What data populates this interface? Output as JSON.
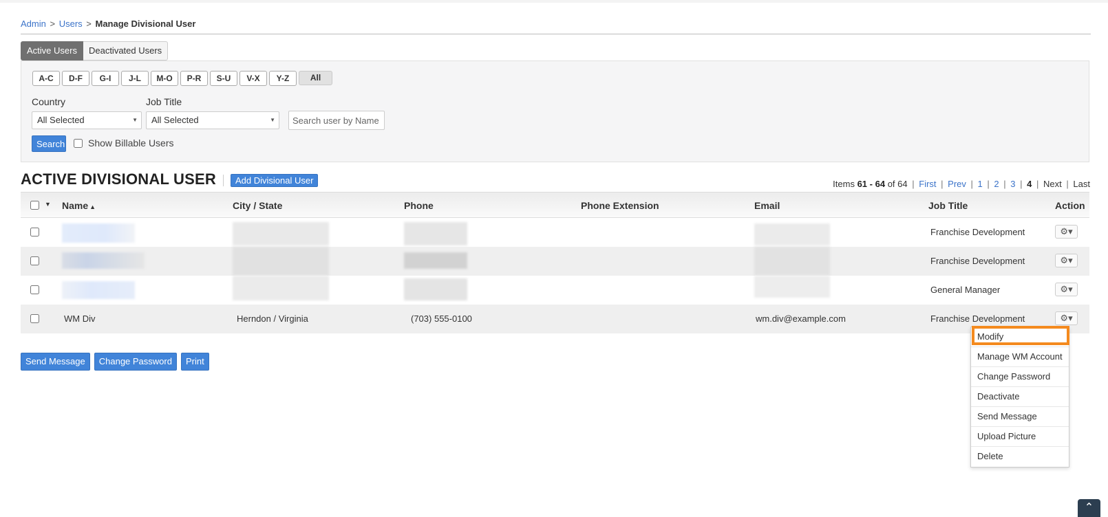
{
  "breadcrumb": {
    "admin": "Admin",
    "users": "Users",
    "current": "Manage Divisional User",
    "sep": ">"
  },
  "tabs": [
    {
      "label": "Active Users"
    },
    {
      "label": "Deactivated Users"
    }
  ],
  "filters": {
    "alpha": [
      "A-C",
      "D-F",
      "G-I",
      "J-L",
      "M-O",
      "P-R",
      "S-U",
      "V-X",
      "Y-Z",
      "All"
    ],
    "country_label": "Country",
    "country_value": "All Selected",
    "job_title_label": "Job Title",
    "job_title_value": "All Selected",
    "search_placeholder": "Search user by Name",
    "search_button": "Search",
    "billable_label": "Show Billable Users"
  },
  "section": {
    "title": "ACTIVE DIVISIONAL USER",
    "add_button": "Add Divisional User"
  },
  "pagination": {
    "items_prefix": "Items",
    "range": "61 - 64",
    "of_text": "of 64",
    "first": "First",
    "prev": "Prev",
    "pages": [
      "1",
      "2",
      "3"
    ],
    "current_page": "4",
    "next": "Next",
    "last": "Last"
  },
  "table": {
    "columns": [
      "Name",
      "City / State",
      "Phone",
      "Phone Extension",
      "Email",
      "Job Title",
      "Action"
    ],
    "rows": [
      {
        "name": "",
        "city_state": "",
        "phone": "",
        "extension": "",
        "email": "",
        "job_title": "Franchise Development"
      },
      {
        "name": "",
        "city_state": "",
        "phone": "",
        "extension": "",
        "email": "",
        "job_title": "Franchise Development"
      },
      {
        "name": "",
        "city_state": "",
        "phone": "",
        "extension": "",
        "email": "",
        "job_title": "General Manager"
      },
      {
        "name": "WM Div",
        "city_state": "Herndon / Virginia",
        "phone": "(703) 555-0100",
        "extension": "",
        "email": "wm.div@example.com",
        "job_title": "Franchise Development"
      }
    ]
  },
  "bottom_buttons": {
    "send_message": "Send Message",
    "change_password": "Change Password",
    "print": "Print"
  },
  "action_menu": [
    "Modify",
    "Manage WM Account",
    "Change Password",
    "Deactivate",
    "Send Message",
    "Upload Picture",
    "Delete"
  ],
  "colors": {
    "accent": "#4184d9",
    "highlight": "#f48a1e",
    "link": "#3b73c9"
  },
  "icons": {
    "action": "gear-icon",
    "scroll_top": "double-chevron-up-icon"
  }
}
